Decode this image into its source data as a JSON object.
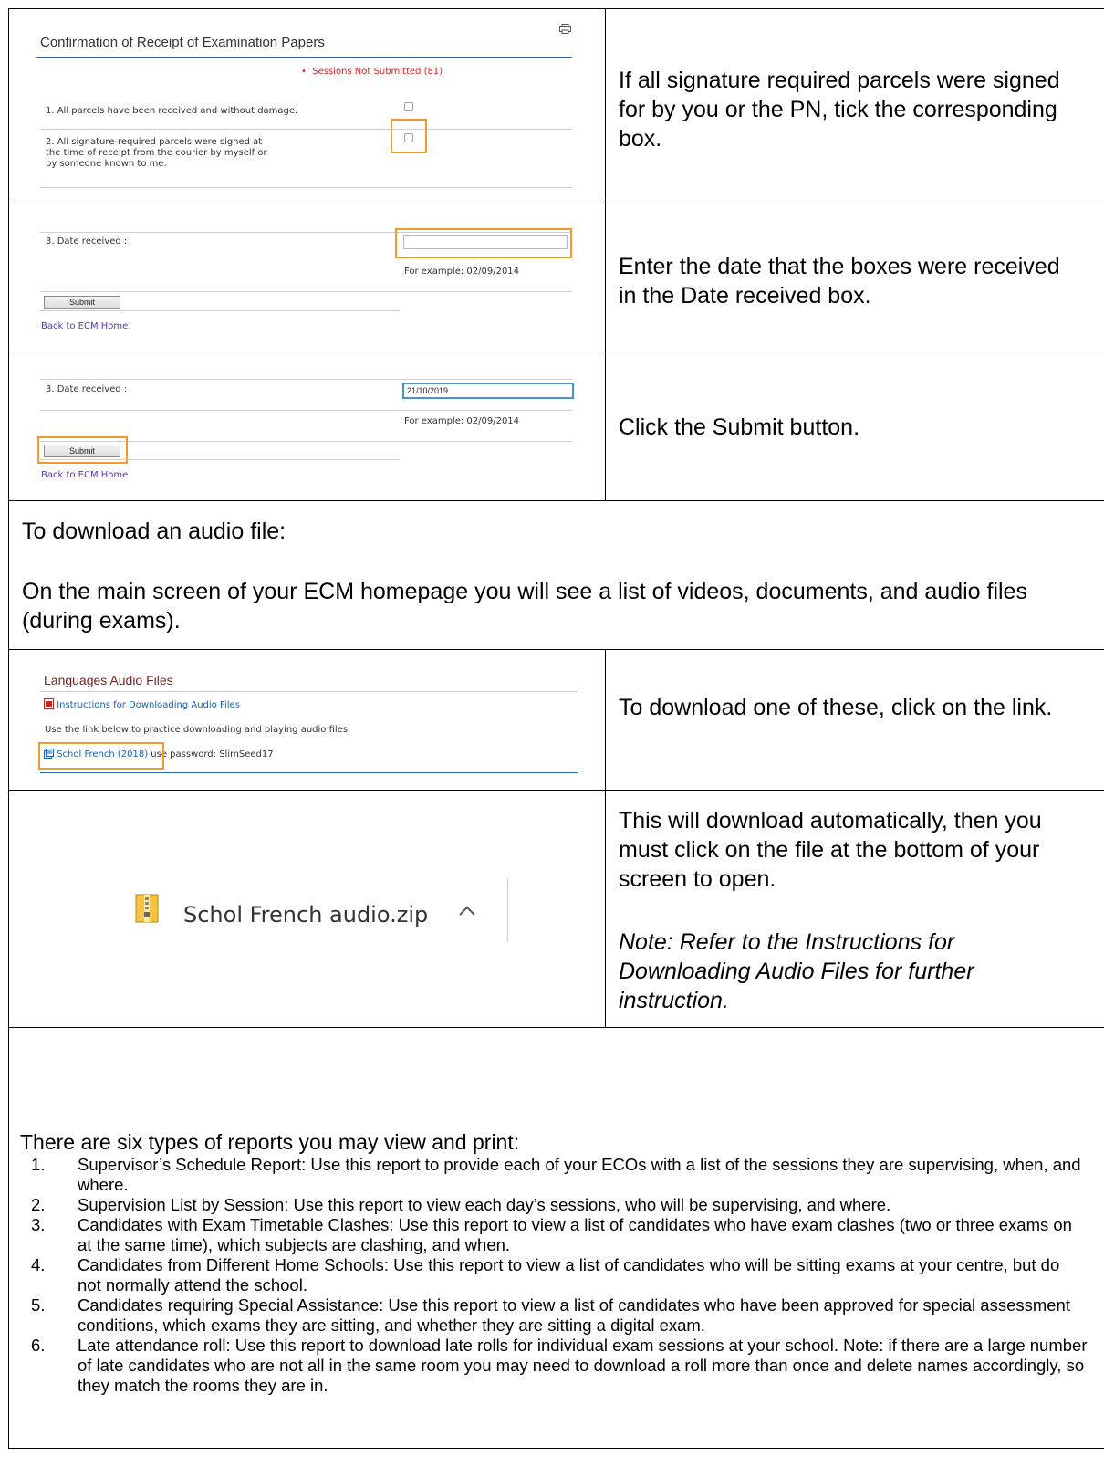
{
  "row1": {
    "title": "Confirmation of Receipt of Examination Papers",
    "print_icon": "printer-icon",
    "sessions_notice": "Sessions Not Submitted (81)",
    "item1": "1. All parcels have been received and without damage.",
    "item2_line1": "2. All signature-required parcels were signed at",
    "item2_line2": "the time of receipt from the courier by myself or",
    "item2_line3": "by someone known to me.",
    "instruction": "If all signature required parcels were signed for by you or the PN, tick the corresponding box."
  },
  "row2": {
    "date_label": "3. Date received :",
    "date_value": "",
    "example": "For example: 02/09/2014",
    "submit_label": "Submit",
    "back_link": "Back to ECM Home.",
    "instruction": "Enter the date that the boxes were received in the Date received box."
  },
  "row3": {
    "date_label": "3. Date received :",
    "date_value": "21/10/2019",
    "example": "For example: 02/09/2014",
    "submit_label": "Submit",
    "back_link": "Back to ECM Home.",
    "instruction": "Click the Submit button."
  },
  "audio_intro": {
    "heading": "To download an audio file:",
    "paragraph": "On the main screen of your ECM homepage you will see a list of videos, documents, and audio files (during exams)."
  },
  "row4": {
    "title": "Languages Audio Files",
    "pdf_link": "Instructions for Downloading Audio Files",
    "practice_text": "Use the link below to practice downloading and playing audio files",
    "audio_link": "Schol French (2018)",
    "password_text": " use password: SlimSeed17",
    "instruction": "To download one of these, click on the link."
  },
  "row5": {
    "zip_name": "Schol French audio.zip",
    "zip_icon": "zip-file-icon",
    "chevron_icon": "chevron-up-icon",
    "instruction": "This will download automatically, then you must click on the file at the bottom of your screen to open.",
    "note": "Note: Refer to the Instructions for Downloading Audio Files for further instruction."
  },
  "reports": {
    "heading": "There are six types of reports you may view and print:",
    "items": [
      {
        "num": "1.",
        "text": "Supervisor’s Schedule Report: Use this report to provide each of your ECOs with a list of the sessions they are supervising, when, and where."
      },
      {
        "num": "2.",
        "text": "Supervision List by Session: Use this report to view each day’s sessions, who will be supervising, and where."
      },
      {
        "num": "3.",
        "text": "Candidates with Exam Timetable Clashes: Use this report to view a list of candidates who have exam clashes (two or three exams on at the same time), which subjects are clashing, and when."
      },
      {
        "num": "4.",
        "text": "Candidates from Different Home Schools: Use this report to view a list of candidates who will be sitting exams at your centre, but do not normally attend the school."
      },
      {
        "num": "5.",
        "text": "Candidates requiring Special Assistance: Use this report to view a list of candidates who have been approved for special assessment conditions, which exams they are sitting, and whether they are sitting a digital exam."
      },
      {
        "num": "6.",
        "text": "Late attendance roll: Use this report to download late rolls for individual exam sessions at your school. Note: if there are a large number of late candidates who are not all in the same room you may need to download a roll more than once and delete names accordingly, so they match the rooms they are in."
      }
    ]
  },
  "colors": {
    "highlight": "#f39a2b",
    "link_blue": "#1a5fb4",
    "link_purple": "#5b39a8",
    "notice_red": "#e02020"
  }
}
